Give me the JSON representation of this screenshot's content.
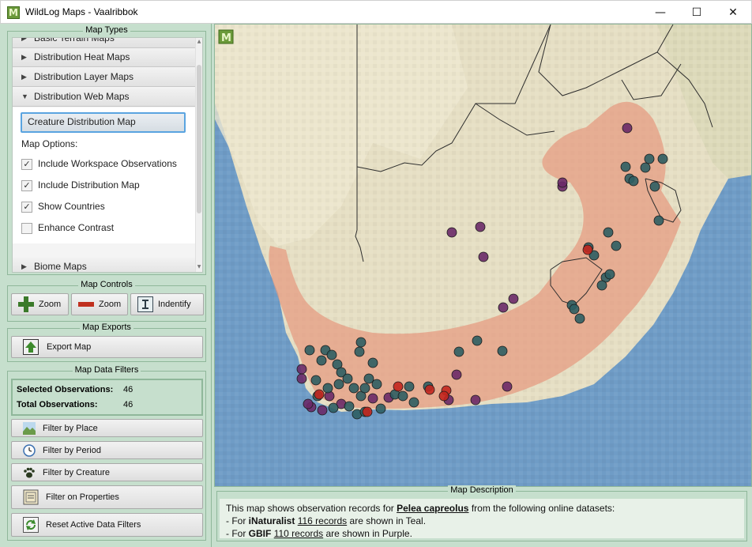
{
  "window": {
    "app_icon": "M",
    "title": "WildLog Maps - Vaalribbok",
    "minimize_glyph": "—",
    "maximize_glyph": "☐",
    "close_glyph": "✕"
  },
  "map_types": {
    "title": "Map Types",
    "rows": [
      {
        "label": "Basic Terrain Maps",
        "arrow": "▶"
      },
      {
        "label": "Distribution Heat Maps",
        "arrow": "▶"
      },
      {
        "label": "Distribution Layer Maps",
        "arrow": "▶"
      },
      {
        "label": "Distribution Web Maps",
        "arrow": "▼"
      },
      {
        "label": "Biome Maps",
        "arrow": "▶"
      }
    ],
    "primary_button": "Creature Distribution Map",
    "options_label": "Map Options:",
    "options": [
      {
        "label": "Include Workspace Observations",
        "checked": "✓"
      },
      {
        "label": "Include Distribution Map",
        "checked": "✓"
      },
      {
        "label": "Show Countries",
        "checked": "✓"
      },
      {
        "label": "Enhance Contrast",
        "checked": ""
      }
    ]
  },
  "map_controls": {
    "title": "Map Controls",
    "zoom_in": "Zoom",
    "zoom_out": "Zoom",
    "identify": "Indentify"
  },
  "map_exports": {
    "title": "Map Exports",
    "export": "Export Map"
  },
  "data_filters": {
    "title": "Map Data Filters",
    "selected_label": "Selected Observations:",
    "selected_value": "46",
    "total_label": "Total Observations:",
    "total_value": "46",
    "buttons": [
      {
        "label": "Filter by Place",
        "icon": "landscape-icon"
      },
      {
        "label": "Filter by Period",
        "icon": "clock-icon"
      },
      {
        "label": "Filter by Creature",
        "icon": "paw-icon"
      },
      {
        "label": "Filter on Properties",
        "icon": "properties-icon"
      },
      {
        "label": "Reset Active Data Filters",
        "icon": "reset-icon"
      }
    ]
  },
  "map": {
    "corner_logo": "M",
    "colors": {
      "ocean": "#6f9cc6",
      "land": "#e6dfc4",
      "distribution": "#e69a80",
      "teal": "#2e5e63",
      "purple": "#6a2a68",
      "red": "#c2261e"
    }
  },
  "description": {
    "title": "Map Description",
    "line1_prefix": "This map shows observation records for ",
    "species": "Pelea capreolus",
    "line1_suffix": " from the following online datasets:",
    "line2_prefix": "- For ",
    "line2_source": "iNaturalist",
    "line2_space": " ",
    "line2_link": "116 records",
    "line2_suffix": " are shown in Teal.",
    "line3_prefix": "- For ",
    "line3_source": "GBIF",
    "line3_space": " ",
    "line3_link": "110 records",
    "line3_suffix": " are shown in Purple."
  }
}
